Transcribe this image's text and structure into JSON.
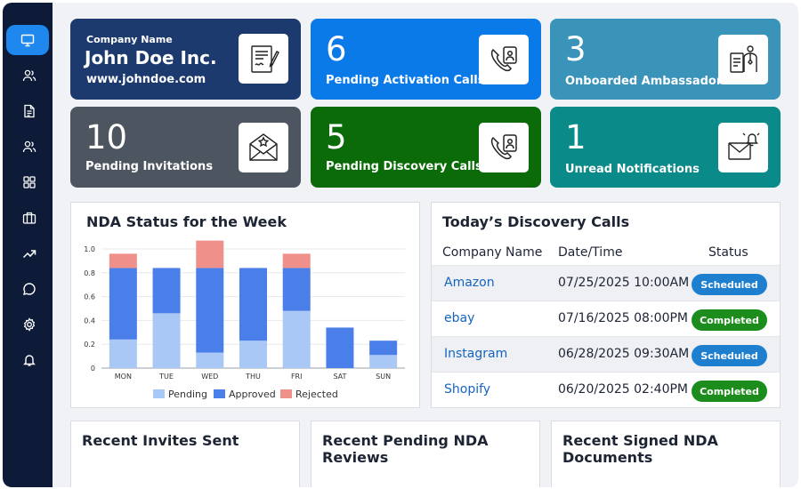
{
  "sidebar": {
    "items": [
      {
        "icon": "monitor-icon",
        "active": true
      },
      {
        "icon": "users-icon"
      },
      {
        "icon": "document-icon"
      },
      {
        "icon": "team-icon"
      },
      {
        "icon": "grid-icon"
      },
      {
        "icon": "briefcase-icon"
      },
      {
        "icon": "trend-icon"
      },
      {
        "icon": "chat-icon"
      },
      {
        "icon": "settings-icon"
      },
      {
        "icon": "bell-icon"
      }
    ]
  },
  "company": {
    "label": "Company Name",
    "name": "John Doe Inc.",
    "website": "www.johndoe.com",
    "icon": "contract-sign-icon",
    "color": "#1d3a6f"
  },
  "stats": [
    {
      "value": "6",
      "label": "Pending Activation Calls",
      "icon": "phone-call-icon",
      "color": "#0a7ae8"
    },
    {
      "value": "3",
      "label": "Onboarded Ambassadors",
      "icon": "ambassador-icon",
      "color": "#3a93b9"
    },
    {
      "value": "10",
      "label": "Pending Invitations",
      "icon": "invitation-icon",
      "color": "#4d5660"
    },
    {
      "value": "5",
      "label": "Pending Discovery Calls",
      "icon": "phone-call-icon",
      "color": "#0a6b08"
    },
    {
      "value": "1",
      "label": "Unread Notifications",
      "icon": "mail-bell-icon",
      "color": "#0a8a88"
    }
  ],
  "chart_data": {
    "type": "bar",
    "title": "NDA Status for the Week",
    "categories": [
      "MON",
      "TUE",
      "WED",
      "THU",
      "FRI",
      "SAT",
      "SUN"
    ],
    "stacked": true,
    "ylim": [
      0,
      1.0
    ],
    "yticks": [
      "0",
      "0.2",
      "0.4",
      "0.6",
      "0.8",
      "1.0"
    ],
    "ytick_values": [
      0,
      0.2,
      0.4,
      0.6,
      0.8,
      1.0
    ],
    "grid": true,
    "legend": "bottom",
    "series": [
      {
        "name": "Pending",
        "color": "#a9c8f5",
        "values": [
          0.24,
          0.46,
          0.13,
          0.23,
          0.48,
          0,
          0.11
        ]
      },
      {
        "name": "Approved",
        "color": "#4a7ee8",
        "values": [
          0.6,
          0.38,
          0.71,
          0.61,
          0.36,
          0.34,
          0.12
        ]
      },
      {
        "name": "Rejected",
        "color": "#f0908a",
        "values": [
          0.12,
          0,
          0.23,
          0,
          0.12,
          0,
          0
        ]
      }
    ]
  },
  "discovery": {
    "title": "Today’s Discovery Calls",
    "columns": [
      "Company Name",
      "Date/Time",
      "Status"
    ],
    "rows": [
      {
        "company": "Amazon",
        "datetime": "07/25/2025 10:00AM",
        "status": "Scheduled",
        "status_color": "#1e7fcf"
      },
      {
        "company": "ebay",
        "datetime": "07/16/2025 08:00PM",
        "status": "Completed",
        "status_color": "#1c8c1c"
      },
      {
        "company": "Instagram",
        "datetime": "06/28/2025 09:30AM",
        "status": "Scheduled",
        "status_color": "#1e7fcf"
      },
      {
        "company": "Shopify",
        "datetime": "06/20/2025 02:40PM",
        "status": "Completed",
        "status_color": "#1c8c1c"
      }
    ]
  },
  "bottom_panels": [
    {
      "title": "Recent Invites Sent"
    },
    {
      "title": "Recent Pending NDA Reviews"
    },
    {
      "title_line1": "Recent Signed NDA",
      "title_line2": "Documents"
    }
  ]
}
